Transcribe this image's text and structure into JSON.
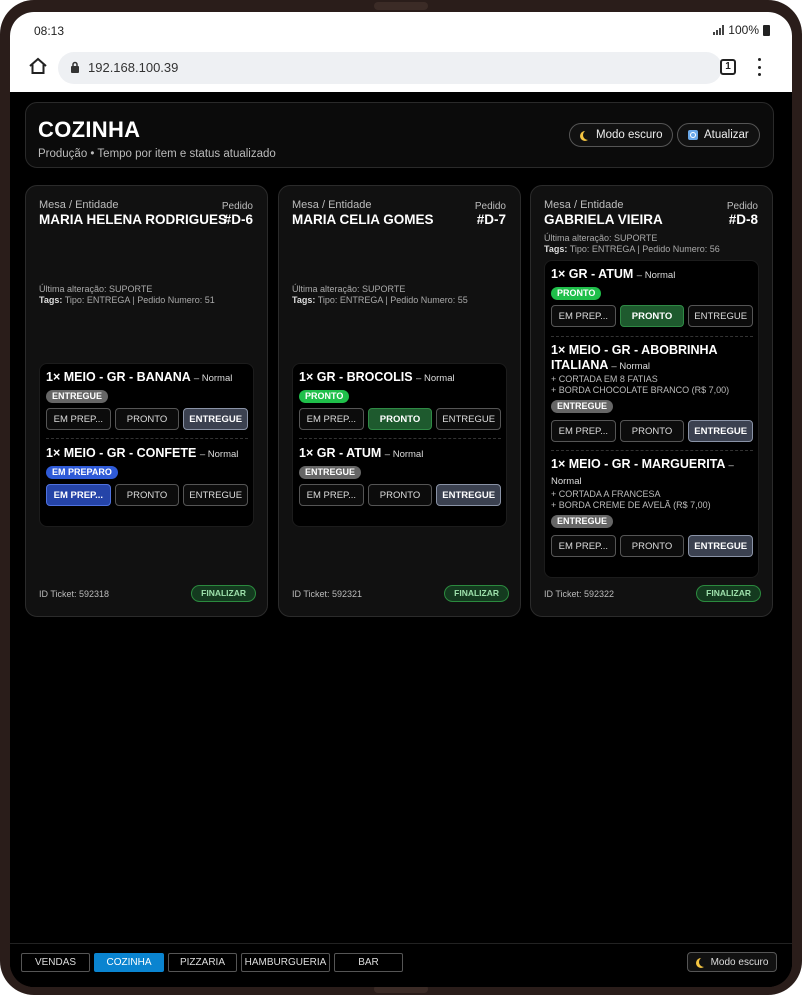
{
  "status_bar": {
    "time": "08:13",
    "battery": "100%"
  },
  "browser": {
    "url": "192.168.100.39",
    "tab_count": "1"
  },
  "header": {
    "title": "COZINHA",
    "subtitle": "Produção • Tempo por item e status atualizado",
    "dark_mode_label": "Modo escuro",
    "refresh_label": "Atualizar"
  },
  "common": {
    "entity_label": "Mesa / Entidade",
    "order_label": "Pedido",
    "finalize_label": "FINALIZAR",
    "btn_preparo": "EM PREP...",
    "btn_pronto": "PRONTO",
    "btn_entregue": "ENTREGUE"
  },
  "orders": [
    {
      "name": "MARIA HELENA RODRIGUES",
      "id": "#D-6",
      "last_change": "Última alteração: SUPORTE",
      "tags_label": "Tags:",
      "tags": "Tipo: ENTREGA | Pedido Numero: 51",
      "ticket": "ID Ticket: 592318",
      "items": [
        {
          "title": "1× MEIO - GR - BANANA",
          "mode": "– Normal",
          "options": [],
          "status": "entregue",
          "badge": "ENTREGUE"
        },
        {
          "title": "1× MEIO - GR - CONFETE",
          "mode": "– Normal",
          "options": [],
          "status": "preparo",
          "badge": "EM PREPARO"
        }
      ]
    },
    {
      "name": "MARIA CELIA GOMES",
      "id": "#D-7",
      "last_change": "Última alteração: SUPORTE",
      "tags_label": "Tags:",
      "tags": "Tipo: ENTREGA | Pedido Numero: 55",
      "ticket": "ID Ticket: 592321",
      "items": [
        {
          "title": "1× GR - BROCOLIS",
          "mode": "– Normal",
          "options": [],
          "status": "pronto",
          "badge": "PRONTO"
        },
        {
          "title": "1× GR - ATUM",
          "mode": "– Normal",
          "options": [],
          "status": "entregue",
          "badge": "ENTREGUE"
        }
      ]
    },
    {
      "name": "GABRIELA VIEIRA",
      "id": "#D-8",
      "last_change": "Última alteração: SUPORTE",
      "tags_label": "Tags:",
      "tags": "Tipo: ENTREGA | Pedido Numero: 56",
      "ticket": "ID Ticket: 592322",
      "items": [
        {
          "title": "1× GR - ATUM",
          "mode": "– Normal",
          "options": [],
          "status": "pronto",
          "badge": "PRONTO"
        },
        {
          "title": "1× MEIO - GR - ABOBRINHA ITALIANA",
          "mode": "– Normal",
          "options": [
            "+ CORTADA EM 8 FATIAS",
            "+ BORDA CHOCOLATE BRANCO (R$ 7,00)"
          ],
          "status": "entregue",
          "badge": "ENTREGUE"
        },
        {
          "title": "1× MEIO - GR - MARGUERITA",
          "mode": "– Normal",
          "options": [
            "+ CORTADA A FRANCESA",
            "+ BORDA CREME DE AVELÃ (R$ 7,00)"
          ],
          "status": "entregue",
          "badge": "ENTREGUE"
        }
      ]
    }
  ],
  "bottom_nav": {
    "tabs": [
      "VENDAS",
      "COZINHA",
      "PIZZARIA",
      "HAMBURGUERIA",
      "BAR"
    ],
    "active": "COZINHA",
    "dark_mode_label": "Modo escuro"
  }
}
